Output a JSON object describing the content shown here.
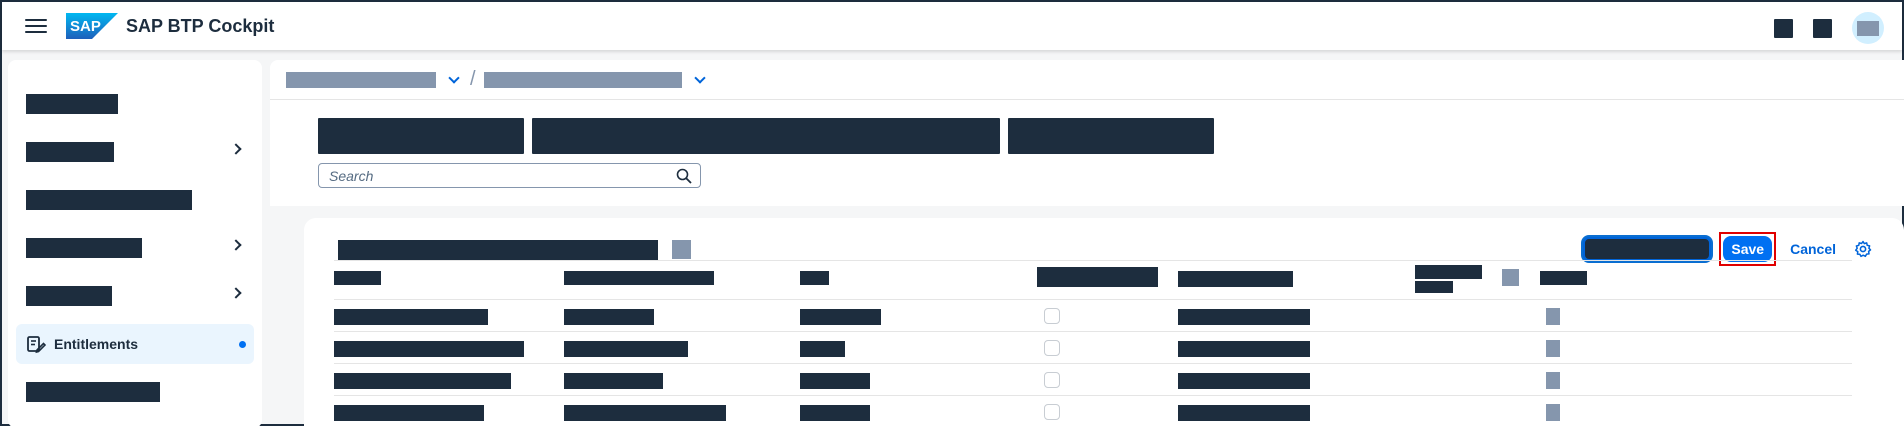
{
  "shell": {
    "app_title": "SAP BTP Cockpit",
    "logo_text": "SAP",
    "icons": [
      "menu-icon",
      "notification-icon",
      "help-icon",
      "user-avatar"
    ]
  },
  "sidebar": {
    "selected_label": "Entitlements",
    "selected_icon": "entitlements-icon",
    "accent_color": "#0070f2"
  },
  "search": {
    "placeholder": "Search"
  },
  "toolbar": {
    "save_label": "Save",
    "cancel_label": "Cancel",
    "settings_icon": "gear-icon"
  },
  "colors": {
    "primary": "#0070f2",
    "link": "#0064d9",
    "shell_text": "#1d2d3e",
    "highlight_border": "#e00000"
  }
}
